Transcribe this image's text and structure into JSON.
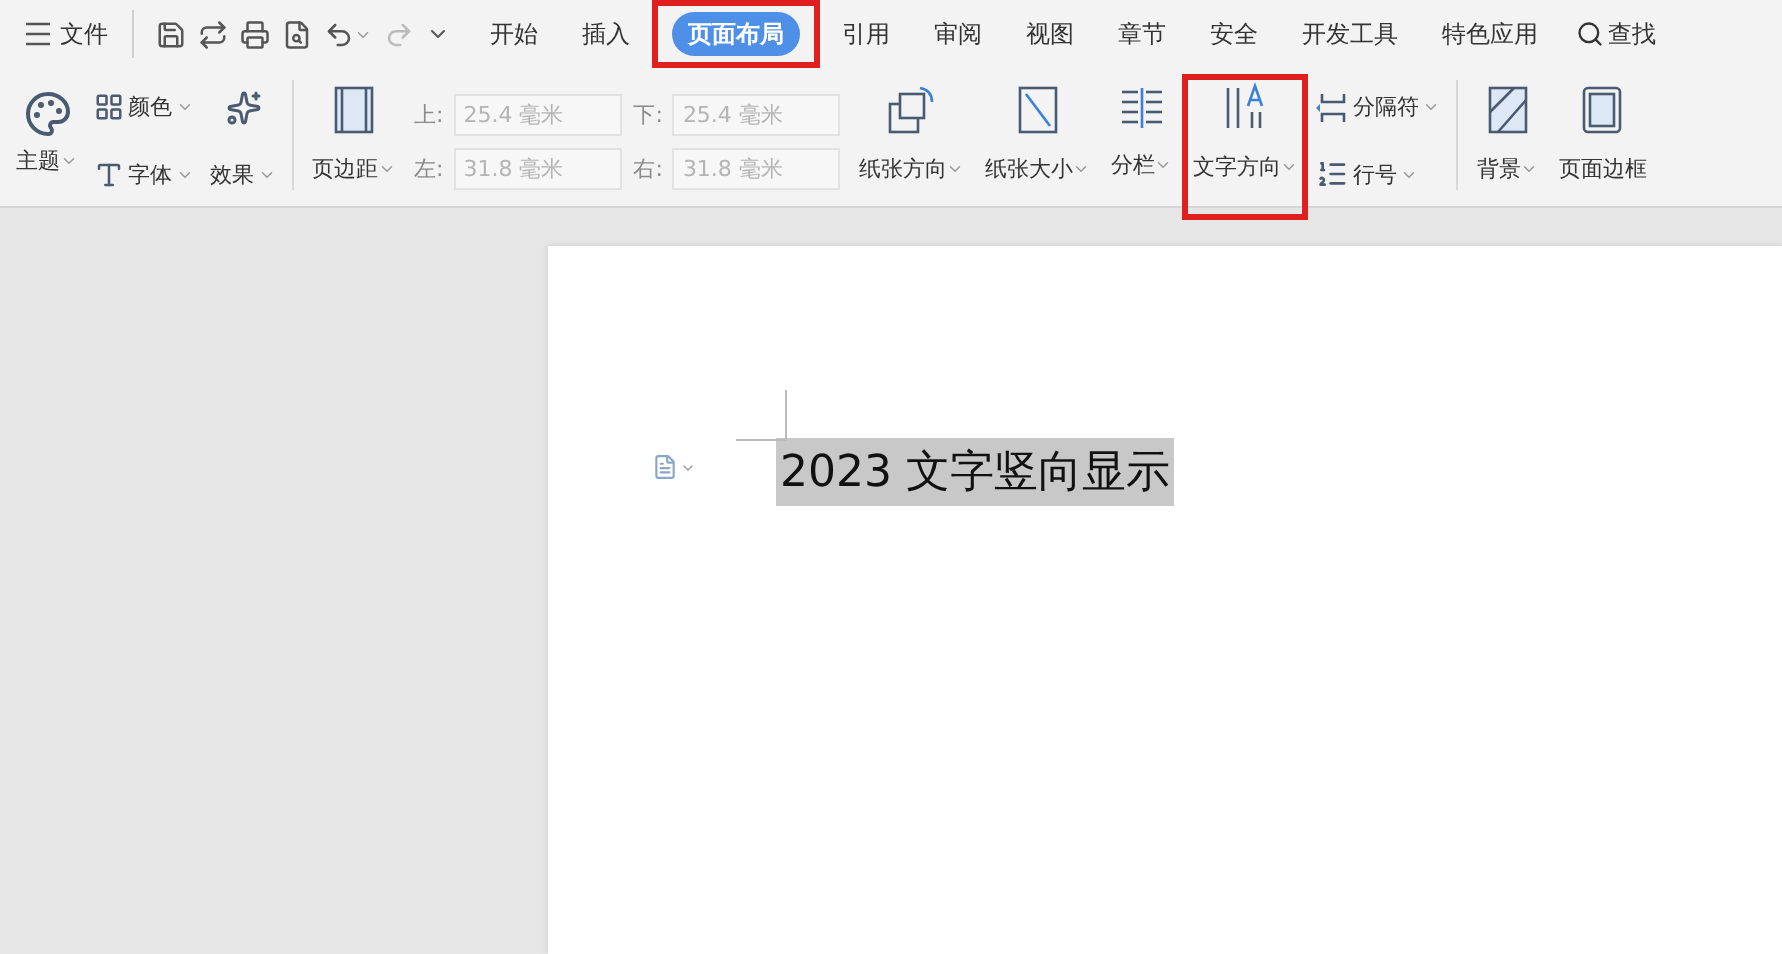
{
  "menu": {
    "file": "文件",
    "tabs": [
      {
        "label": "开始",
        "selected": false,
        "highlighted": false
      },
      {
        "label": "插入",
        "selected": false,
        "highlighted": false
      },
      {
        "label": "页面布局",
        "selected": true,
        "highlighted": true
      },
      {
        "label": "引用",
        "selected": false,
        "highlighted": false
      },
      {
        "label": "审阅",
        "selected": false,
        "highlighted": false
      },
      {
        "label": "视图",
        "selected": false,
        "highlighted": false
      },
      {
        "label": "章节",
        "selected": false,
        "highlighted": false
      },
      {
        "label": "安全",
        "selected": false,
        "highlighted": false
      },
      {
        "label": "开发工具",
        "selected": false,
        "highlighted": false
      },
      {
        "label": "特色应用",
        "selected": false,
        "highlighted": false
      }
    ],
    "search": "查找"
  },
  "ribbon": {
    "theme": {
      "theme": "主题",
      "colors_label": "颜色",
      "font": "字体",
      "effect": "效果"
    },
    "margins": {
      "label": "页边距",
      "disabled": true,
      "fields": [
        {
          "label": "上:",
          "value": "25.4 毫米"
        },
        {
          "label": "下:",
          "value": "25.4 毫米"
        },
        {
          "label": "左:",
          "value": "31.8 毫米"
        },
        {
          "label": "右:",
          "value": "31.8 毫米"
        }
      ]
    },
    "buttons": [
      {
        "kind": "orientation",
        "label": "纸张方向",
        "highlighted": false
      },
      {
        "kind": "size",
        "label": "纸张大小",
        "highlighted": false
      },
      {
        "kind": "columns",
        "label": "分栏",
        "highlighted": false
      },
      {
        "kind": "text-direction",
        "label": "文字方向",
        "highlighted": true
      }
    ],
    "small": [
      {
        "kind": "breaks",
        "label": "分隔符"
      },
      {
        "kind": "line-numbers",
        "label": "行号"
      }
    ],
    "page_buttons": [
      {
        "kind": "background",
        "label": "背景",
        "dropdown": true
      },
      {
        "kind": "border",
        "label": "页面边框",
        "dropdown": false
      }
    ]
  },
  "document": {
    "text": "2023 文字竖向显示",
    "selected": true
  }
}
